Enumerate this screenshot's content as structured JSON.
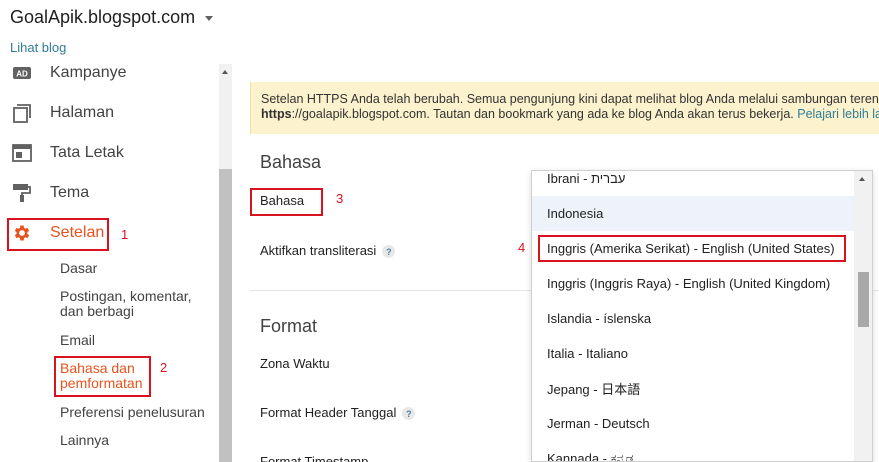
{
  "header": {
    "blog_title": "GoalApik.blogspot.com",
    "view_blog": "Lihat blog"
  },
  "sidebar": {
    "items": [
      {
        "label": "Kampanye",
        "icon": "ad-icon"
      },
      {
        "label": "Halaman",
        "icon": "pages-icon"
      },
      {
        "label": "Tata Letak",
        "icon": "layout-icon"
      },
      {
        "label": "Tema",
        "icon": "theme-roller-icon"
      },
      {
        "label": "Setelan",
        "icon": "gear-icon"
      }
    ],
    "sub_items": [
      {
        "label": "Dasar"
      },
      {
        "label": "Postingan, komentar, dan berbagi"
      },
      {
        "label": "Email"
      },
      {
        "label": "Bahasa dan pemformatan"
      },
      {
        "label": "Preferensi penelusuran"
      },
      {
        "label": "Lainnya"
      }
    ]
  },
  "notice": {
    "line1": "Setelan HTTPS Anda telah berubah. Semua pengunjung kini dapat melihat blog Anda melalui sambungan terenkripsi di",
    "line2_bold": "https",
    "line2_text": "://goalapik.blogspot.com. Tautan dan bookmark yang ada ke blog Anda akan terus bekerja.",
    "link": "Pelajari lebih lanjut"
  },
  "main": {
    "section_language": "Bahasa",
    "field_language": "Bahasa",
    "field_transliteration": "Aktifkan transliterasi",
    "section_format": "Format",
    "field_timezone": "Zona Waktu",
    "field_date_header": "Format Header Tanggal",
    "field_timestamp": "Format Timestamp",
    "help_glyph": "?"
  },
  "dropdown": {
    "options": [
      "Ibrani - עברית",
      "Indonesia",
      "Inggris (Amerika Serikat) - English (United States)",
      "Inggris (Inggris Raya) - English (United Kingdom)",
      "Islandia - íslenska",
      "Italia - Italiano",
      "Jepang - 日本語",
      "Jerman - Deutsch",
      "Kannada - ಕನ್ನಡ"
    ]
  },
  "annotations": {
    "n1": "1",
    "n2": "2",
    "n3": "3",
    "n4": "4",
    "color": "#d9121f"
  },
  "colors": {
    "accent": "#e8531d",
    "link": "#2f7d99",
    "notice_bg": "#fcf2cd",
    "hover_bg": "#edf2fb"
  }
}
